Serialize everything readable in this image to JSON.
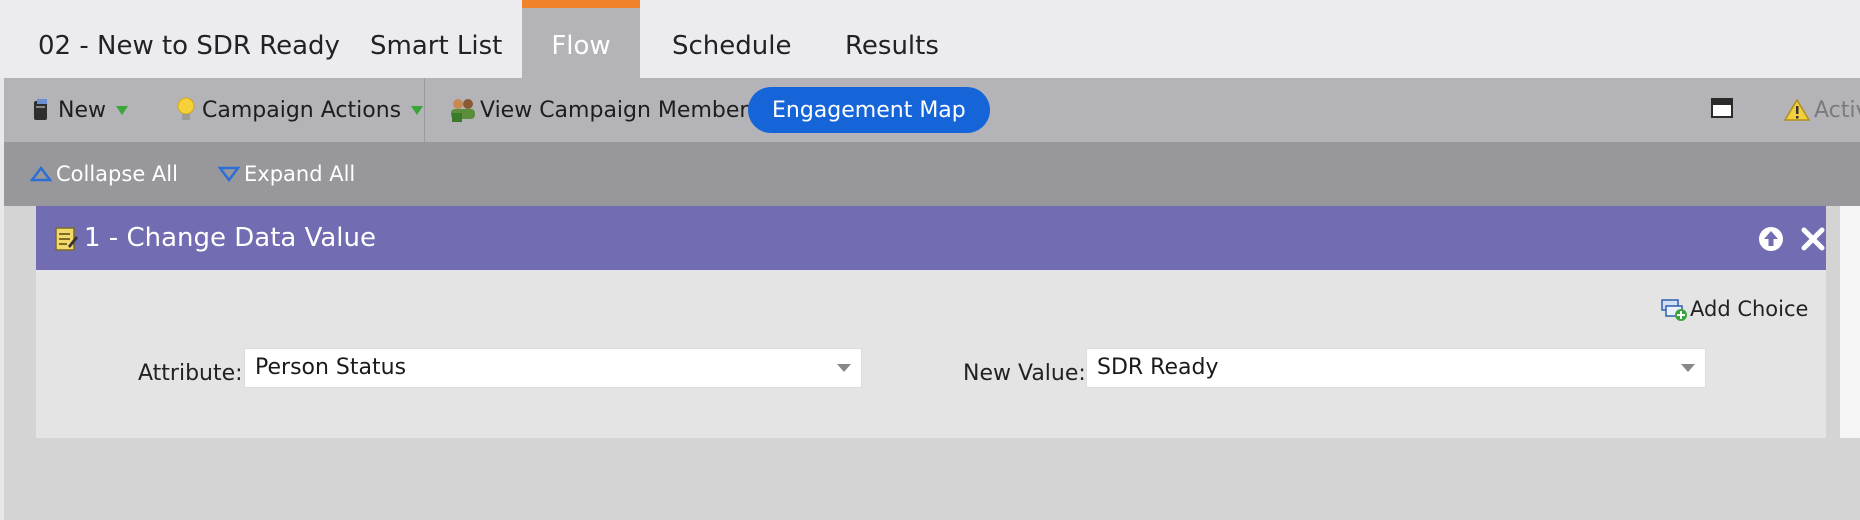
{
  "tabs": {
    "program": "02 - New to SDR Ready",
    "smart_list": "Smart List",
    "flow": "Flow",
    "schedule": "Schedule",
    "results": "Results"
  },
  "toolbar": {
    "new_label": "New",
    "campaign_actions_label": "Campaign Actions",
    "view_members_label": "View Campaign Members",
    "engagement_map_label": "Engagement Map",
    "active_label": "Active"
  },
  "subbar": {
    "collapse_label": "Collapse All",
    "expand_label": "Expand All"
  },
  "step": {
    "title": "1 - Change Data Value",
    "add_choice_label": "Add Choice",
    "attribute_label": "Attribute:",
    "attribute_value": "Person Status",
    "new_value_label": "New Value:",
    "new_value_value": "SDR Ready"
  },
  "colors": {
    "flow_accent": "#f0822c",
    "step_header": "#726db2",
    "engagement_button": "#1565d8"
  },
  "icons": [
    "new-icon",
    "lightbulb-icon",
    "members-icon",
    "window-icon",
    "warning-icon",
    "collapse-icon",
    "expand-icon",
    "edit-note-icon",
    "arrow-up-icon",
    "close-icon",
    "add-choice-icon"
  ]
}
